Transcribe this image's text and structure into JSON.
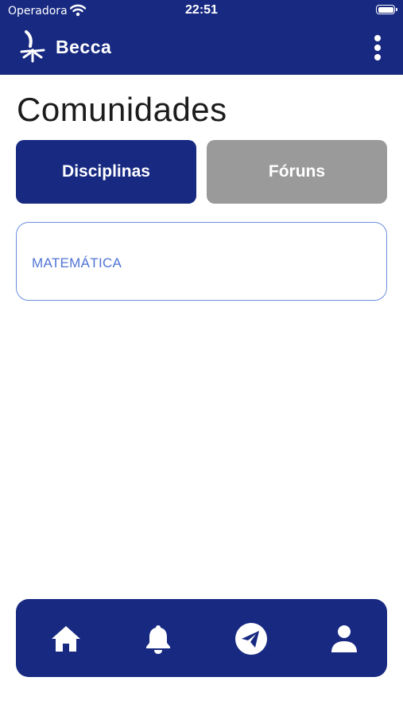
{
  "status_bar": {
    "carrier": "Operadora",
    "time": "22:51",
    "wifi_icon": "wifi-icon",
    "battery_icon": "battery-icon"
  },
  "header": {
    "app_name": "Becca",
    "logo_icon": "becca-logo-icon",
    "menu_icon": "more-vertical-icon",
    "background_color": "#172981"
  },
  "page": {
    "title": "Comunidades"
  },
  "tabs": [
    {
      "label": "Disciplinas",
      "active": true,
      "color": "#172981"
    },
    {
      "label": "Fóruns",
      "active": false,
      "color": "#9a9a9a"
    }
  ],
  "communities": [
    {
      "label": "MATEMÁTICA"
    }
  ],
  "bottom_nav": {
    "items": [
      {
        "icon": "home-icon"
      },
      {
        "icon": "bell-icon"
      },
      {
        "icon": "send-icon"
      },
      {
        "icon": "user-icon"
      }
    ]
  },
  "colors": {
    "primary": "#172981",
    "inactive_tab": "#9a9a9a",
    "card_border": "#6b8fe0",
    "card_text": "#4f74d6"
  }
}
